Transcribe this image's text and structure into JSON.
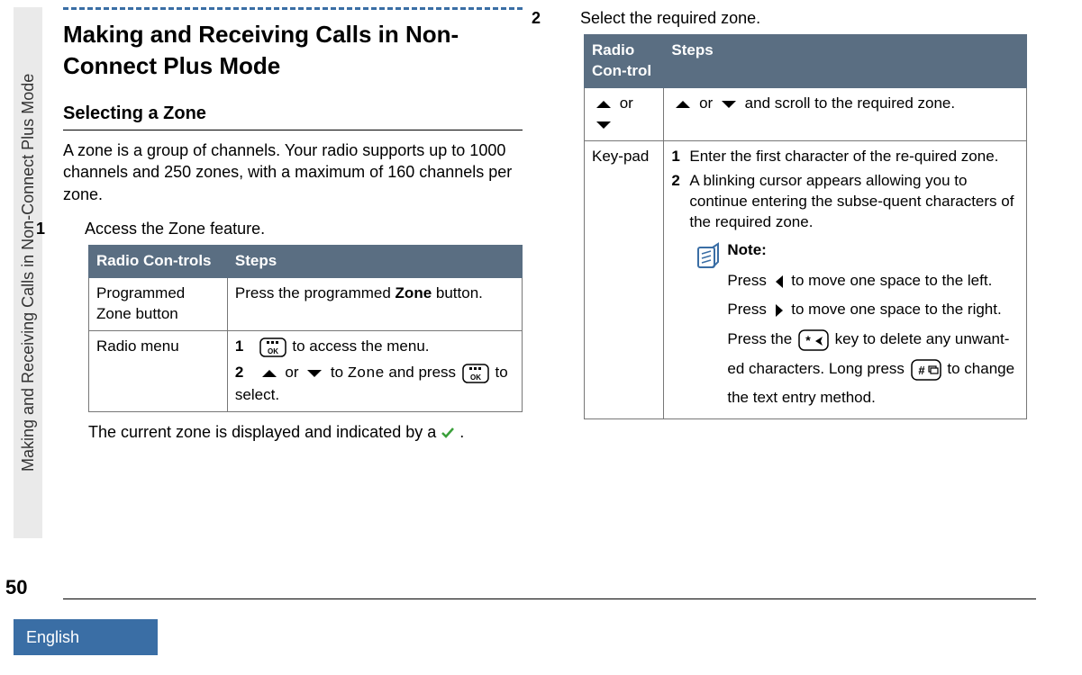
{
  "sidebar": {
    "tab_title": "Making and Receiving Calls in Non-Connect Plus Mode",
    "page_number": "50",
    "language": "English"
  },
  "left": {
    "h1": "Making and Receiving Calls in Non-Connect Plus Mode",
    "h2": "Selecting a Zone",
    "intro": "A zone is a group of channels. Your radio supports up to 1000 channels and 250 zones, with a maximum of 160 channels per zone.",
    "step1_num": "1",
    "step1": "Access the Zone feature.",
    "table": {
      "th1": "Radio Con-trols",
      "th2": "Steps",
      "r1c1": "Programmed Zone button",
      "r1c2a": "Press the programmed ",
      "r1c2b": "Zone",
      "r1c2c": " button.",
      "r2c1": "Radio menu",
      "r2s1n": "1",
      "r2s1": " to access the menu.",
      "r2s2n": "2",
      "r2s2a": " or ",
      "r2s2b": " to ",
      "r2s2c": "Zone",
      "r2s2d": " and press ",
      "r2s2e": " to select."
    },
    "after": "The current zone is displayed and indicated by a ",
    "after2": "."
  },
  "right": {
    "step2_num": "2",
    "step2": "Select the required zone.",
    "table": {
      "th1": "Radio Con-trol",
      "th2": "Steps",
      "r1c1a": " or ",
      "r1c2a": " or ",
      "r1c2b": " and scroll to the required zone.",
      "r2c1": "Key-pad",
      "r2s1n": "1",
      "r2s1": "Enter the first character of the re-quired zone.",
      "r2s2n": "2",
      "r2s2": "A blinking cursor appears allowing you to continue entering the subse-quent characters of the required zone.",
      "note_title": "Note:",
      "note_a": "Press ",
      "note_b": " to move one space to the left. Press ",
      "note_c": " to move one space to the right. Press the ",
      "note_d": " key to delete any unwant-ed characters. Long press ",
      "note_e": " to change the text entry method."
    }
  }
}
